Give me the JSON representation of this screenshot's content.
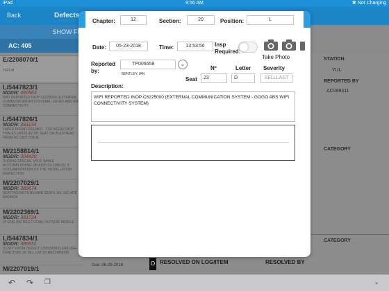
{
  "status_bar": {
    "device": "iPad",
    "time": "9:56 AM",
    "battery": "Not Charging"
  },
  "nav": {
    "back_label": "Back",
    "title": "Defects"
  },
  "list_header": {
    "show_label": "SHOW FI",
    "ac_label": "AC: 405"
  },
  "defects": [
    {
      "title": "E/2208070/1",
      "mddr_label": "",
      "mddr": "",
      "desc": "TFFDH"
    },
    {
      "title": "L/5447823/1",
      "mddr_label": "MDDR:",
      "mddr": "390563",
      "desc": "WIFI REPORTED INOP C6225000 (EXTERNAL COMMUNICATION SYSTEMS - GOGO ABS WIFI CONNECTIVITY"
    },
    {
      "title": "L/5447826/1",
      "mddr_label": "MDDR:",
      "mddr": "391134",
      "desc": "TAPED FROM C6510800 - TSD 50SDU INOP THALES (4500) AVOID SEAT OR BULKHEAD FROM AC UNIT ISSUE"
    },
    {
      "title": "M/2158814/1",
      "mddr_label": "MDDR:",
      "mddr": "304420",
      "desc": "DURING SPECIAL VISIT, WHILE ACCOMPLISHING SB A320-53-1280-02, A DOCUMENTATION OF THE INSTALLATION INSPECTION"
    },
    {
      "title": "M/2207029/1",
      "mddr_label": "MDDR:",
      "mddr": "389674",
      "desc": "SEAT POCKETS BEHIND SEATS 10L 16C ARE BROKEN"
    },
    {
      "title": "M/2202369/1",
      "mddr_label": "MDDR:",
      "mddr": "381724",
      "desc": "#2 ENG AIR INLET COWL OUTSIDE MIDDLE"
    },
    {
      "title": "L/5447834/1",
      "mddr_label": "MDDR:",
      "mddr": "386551",
      "desc": "(COPY FROM DEFECT L/5293436/1) FAILURE FUNCTION OF SILL LATCH MECHANISM"
    },
    {
      "title": "M/2207019/1",
      "mddr_label": "",
      "mddr": "",
      "desc": ""
    }
  ],
  "right_pane": {
    "station_label": "STATION",
    "station_value": "YUL",
    "reported_by_label": "REPORTED BY",
    "reported_by_value": "AC089411",
    "category_label_1": "CATEGORY",
    "category_label_2": "CATEGORY"
  },
  "bottom_strip": {
    "due": "Due: 08-29-2018",
    "marker": "O",
    "resolved_on": "RESOLVED ON LOG/ITEM",
    "resolved_by": "RESOLVED BY"
  },
  "form": {
    "chapter_label": "Chapter:",
    "chapter_value": "12",
    "section_label": "Section:",
    "section_value": "20",
    "position_label": "Position:",
    "position_value": "L",
    "date_label": "Date:",
    "date_value": "05-23-2018",
    "time_label": "Time:",
    "time_value": "13:53:56",
    "insp_label_1": "Insp",
    "insp_label_2": "Required:",
    "take_photo_label": "Take Photo",
    "reported_by_label_1": "Reported",
    "reported_by_label_2": "by:",
    "reported_by_value": "TP006658",
    "reported_by_name": "BENTLEY, IAN",
    "seat_label": "Seat",
    "no_label": "Nº",
    "letter_label": "Letter",
    "severity_label": "Severity",
    "seat_no_value": "23",
    "seat_letter_value": "D",
    "severity_placeholder": "SELLLAST",
    "description_label": "Description:",
    "description_value": "WIFI REPORTED INOP C6225000 (EXTERNAL COMMUNICATION SYSTEM - GOGO ABS WIFI CONNECTIVITY SYSTEM)"
  },
  "colors": {
    "accent": "#1b85c8",
    "mddr": "#7e2b2b"
  },
  "icons": [
    "undo-icon",
    "redo-icon",
    "copy-icon",
    "chevron-down-icon",
    "camera-icon",
    "bluetooth-icon"
  ]
}
